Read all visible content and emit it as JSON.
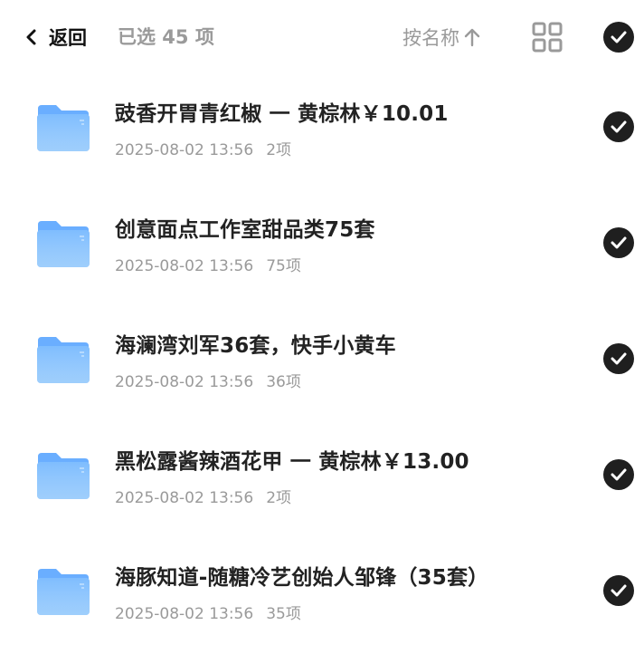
{
  "header": {
    "back_label": "返回",
    "selected_text": "已选 45 项",
    "sort_label": "按名称"
  },
  "colors": {
    "folder_top": "#6aaeff",
    "folder_body": "#8ec5fb",
    "check_bg": "#1f1f1f",
    "muted_text": "#9a9a9a"
  },
  "items": [
    {
      "name": "豉香开胃青红椒 一 黄棕林￥10.01",
      "date": "2025-08-02 13:56",
      "count": "2项",
      "selected": true
    },
    {
      "name": "创意面点工作室甜品类75套",
      "date": "2025-08-02 13:56",
      "count": "75项",
      "selected": true
    },
    {
      "name": "海澜湾刘军36套，快手小黄车",
      "date": "2025-08-02 13:56",
      "count": "36项",
      "selected": true
    },
    {
      "name": "黑松露酱辣酒花甲 一 黄棕林￥13.00",
      "date": "2025-08-02 13:56",
      "count": "2项",
      "selected": true
    },
    {
      "name": "海豚知道-随糖冷艺创始人邹锋（35套）",
      "date": "2025-08-02 13:56",
      "count": "35项",
      "selected": true
    }
  ]
}
